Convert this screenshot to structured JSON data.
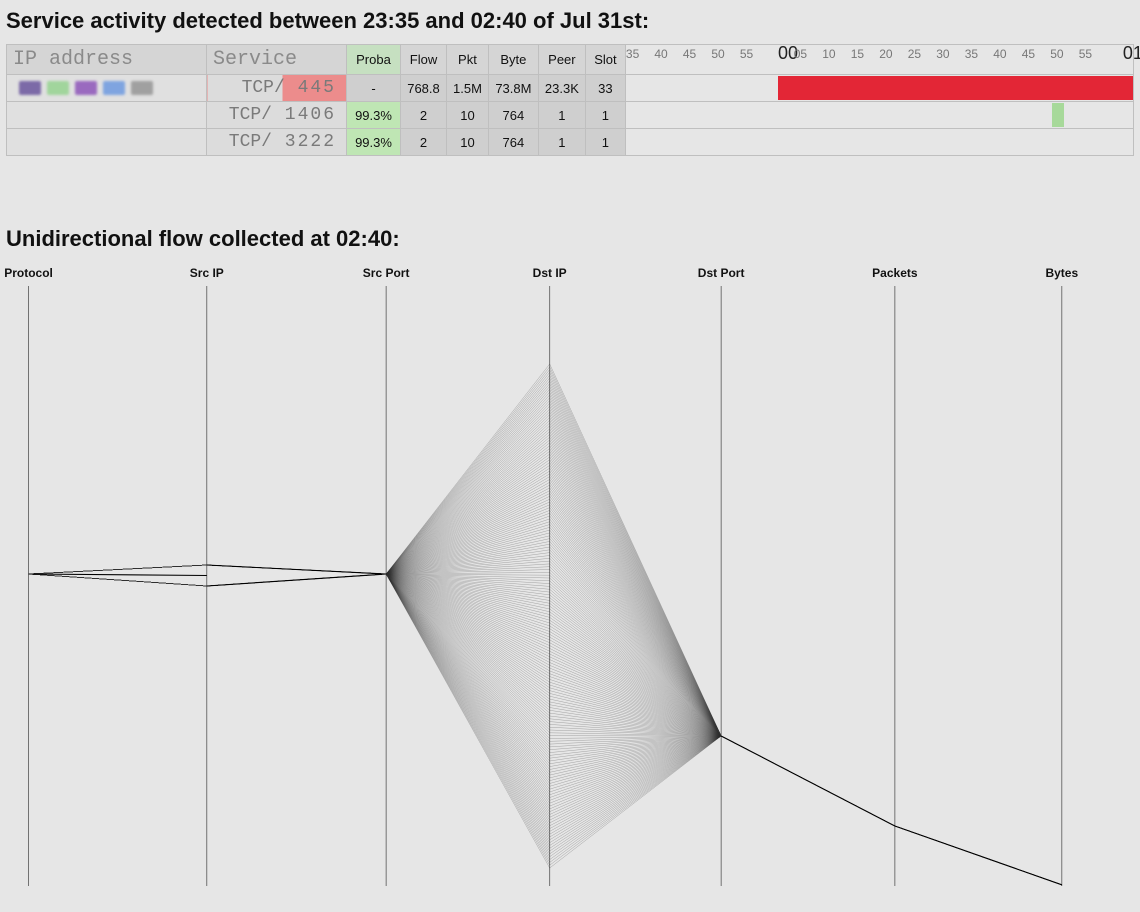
{
  "titles": {
    "activity": "Service activity detected between 23:35 and 02:40 of Jul 31st:",
    "flow": "Unidirectional flow collected at 02:40:"
  },
  "table": {
    "headers": {
      "ip": "IP address",
      "service": "Service",
      "proba": "Proba",
      "flow": "Flow",
      "pkt": "Pkt",
      "byte": "Byte",
      "peer": "Peer",
      "slot": "Slot"
    },
    "timeline": {
      "minor_ticks": [
        "35",
        "40",
        "45",
        "50",
        "55",
        "05",
        "10",
        "15",
        "20",
        "25",
        "30",
        "35",
        "40",
        "45",
        "50",
        "55"
      ],
      "major_ticks": [
        "00",
        "01"
      ],
      "major_positions_pct": [
        30.0,
        98.0
      ],
      "start_pct": 0,
      "tick_spacing_pct": 5.62
    },
    "rows": [
      {
        "ip_redacted": true,
        "proto": "TCP/",
        "port": "445",
        "port_highlight": true,
        "proba": "-",
        "flow": "768.8",
        "pkt": "1.5M",
        "byte": "73.8M",
        "peer": "23.3K",
        "slot": "33",
        "bars": [
          {
            "color": "red",
            "start_pct": 30.0,
            "end_pct": 100.0
          }
        ]
      },
      {
        "ip_redacted": false,
        "proto": "TCP/",
        "port": "1406",
        "port_highlight": false,
        "proba": "99.3%",
        "flow": "2",
        "pkt": "10",
        "byte": "764",
        "peer": "1",
        "slot": "1",
        "bars": [
          {
            "color": "green",
            "start_pct": 84.0,
            "end_pct": 86.3
          }
        ]
      },
      {
        "ip_redacted": false,
        "proto": "TCP/",
        "port": "3222",
        "port_highlight": false,
        "proba": "99.3%",
        "flow": "2",
        "pkt": "10",
        "byte": "764",
        "peer": "1",
        "slot": "1",
        "bars": []
      }
    ]
  },
  "chart_data": {
    "type": "parallel-coordinates",
    "title": "Unidirectional flow collected at 02:40",
    "axes": [
      "Protocol",
      "Src IP",
      "Src Port",
      "Dst IP",
      "Dst Port",
      "Packets",
      "Bytes"
    ],
    "axis_x_pct": [
      2.0,
      17.8,
      33.7,
      48.2,
      63.4,
      78.8,
      93.6
    ],
    "fan": {
      "from_axis": 2,
      "origin_y_pct": 0.48,
      "to_axis": 3,
      "min_y_pct": 0.13,
      "max_y_pct": 0.97,
      "count": 180
    },
    "funnel": {
      "from_axis": 3,
      "to_axis": 4,
      "target_y_pct": 0.75
    },
    "lead_in": {
      "protocol_y_pct": 0.48,
      "srcip_low_pct": 0.465,
      "srcip_high_pct": 0.5,
      "srcport_y_pct": 0.48
    },
    "tail": {
      "packets_y_pct": 0.9,
      "bytes_y_pct": 0.998
    }
  }
}
